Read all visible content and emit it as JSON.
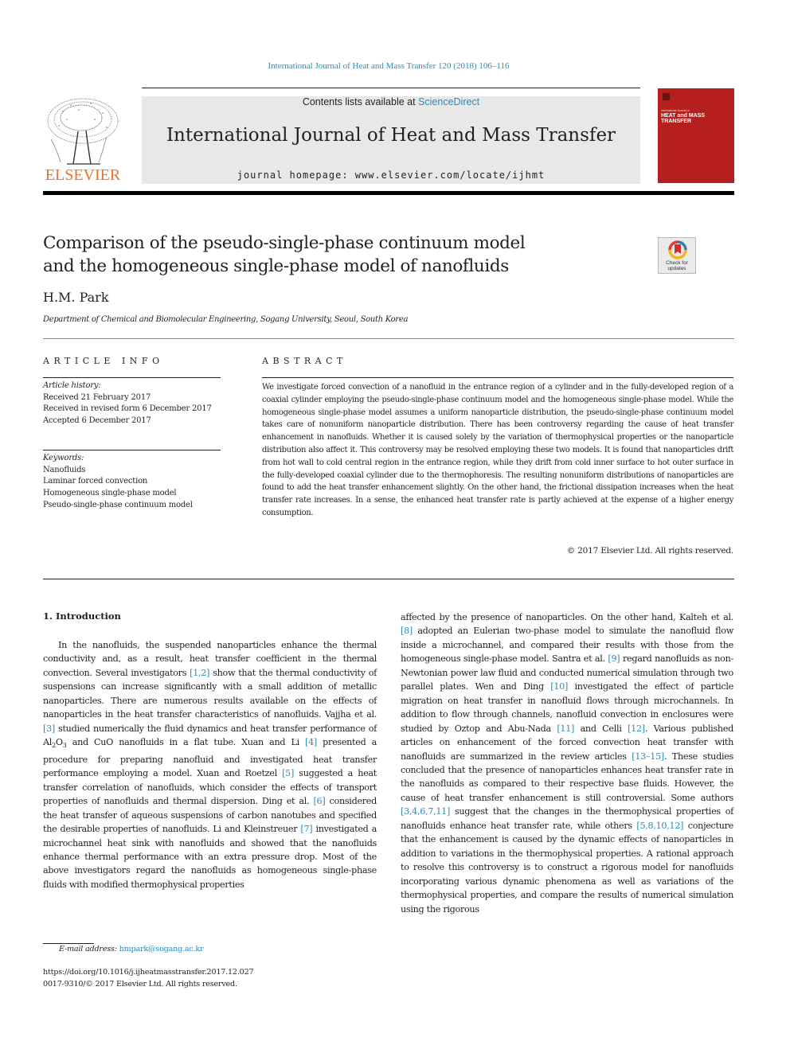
{
  "header": {
    "running_head": "International Journal of Heat and Mass Transfer 120 (2018) 106–116",
    "publisher_logo_text": "ELSEVIER",
    "contents_prefix": "Contents lists available at ",
    "contents_link": "ScienceDirect",
    "journal_title": "International Journal of Heat and Mass Transfer",
    "homepage": "journal homepage: www.elsevier.com/locate/ijhmt",
    "cover": {
      "small_line": "International Journal of",
      "big_line_1": "HEAT and MASS",
      "big_line_2": "TRANSFER",
      "color": "#b5201e"
    }
  },
  "article": {
    "title_line_1": "Comparison of the pseudo-single-phase continuum model",
    "title_line_2": "and the homogeneous single-phase model of nanofluids",
    "check_badge_line_1": "Check for",
    "check_badge_line_2": "updates",
    "author": "H.M. Park",
    "affiliation": "Department of Chemical and Biomolecular Engineering, Sogang University, Seoul, South Korea"
  },
  "article_info": {
    "heading": "ARTICLE INFO",
    "history_label": "Article history:",
    "history": [
      "Received 21 February 2017",
      "Received in revised form 6 December 2017",
      "Accepted 6 December 2017"
    ],
    "keywords_label": "Keywords:",
    "keywords": [
      "Nanofluids",
      "Laminar forced convection",
      "Homogeneous single-phase model",
      "Pseudo-single-phase continuum model"
    ]
  },
  "abstract": {
    "heading": "ABSTRACT",
    "text": "We investigate forced convection of a nanofluid in the entrance region of a cylinder and in the fully-developed region of a coaxial cylinder employing the pseudo-single-phase continuum model and the homogeneous single-phase model. While the homogeneous single-phase model assumes a uniform nanoparticle distribution, the pseudo-single-phase continuum model takes care of nonuniform nanoparticle distribution. There has been controversy regarding the cause of heat transfer enhancement in nanofluids. Whether it is caused solely by the variation of thermophysical properties or the nanoparticle distribution also affect it. This controversy may be resolved employing these two models. It is found that nanoparticles drift from hot wall to cold central region in the entrance region, while they drift from cold inner surface to hot outer surface in the fully-developed coaxial cylinder due to the thermophoresis. The resulting nonuniform distributions of nanoparticles are found to add the heat transfer enhancement slightly. On the other hand, the frictional dissipation increases when the heat transfer rate increases. In a sense, the enhanced heat transfer rate is partly achieved at the expense of a higher energy consumption.",
    "copyright": "© 2017 Elsevier Ltd. All rights reserved."
  },
  "introduction": {
    "heading": "1. Introduction",
    "left_column": [
      {
        "t": "In the nanofluids, the suspended nanoparticles enhance the thermal conductivity and, as a result, heat transfer coefficient in the thermal convection. Several investigators "
      },
      {
        "ref": "[1,2]"
      },
      {
        "t": " show that the thermal conductivity of suspensions can increase significantly with a small addition of metallic nanoparticles. There are numerous results available on the effects of nanoparticles in the heat transfer characteristics of nanofluids. Vajjha et al. "
      },
      {
        "ref": "[3]"
      },
      {
        "t": " studied numerically the fluid dynamics and heat transfer performance of Al"
      },
      {
        "sub": "2"
      },
      {
        "t": "O"
      },
      {
        "sub": "3"
      },
      {
        "t": " and CuO nanofluids in a flat tube. Xuan and Li "
      },
      {
        "ref": "[4]"
      },
      {
        "t": " presented a procedure for preparing nanofluid and investigated heat transfer performance employing a model. Xuan and Roetzel "
      },
      {
        "ref": "[5]"
      },
      {
        "t": " suggested a heat transfer correlation of nanofluids, which consider the effects of transport properties of nanofluids and thermal dispersion. Ding et al. "
      },
      {
        "ref": "[6]"
      },
      {
        "t": " considered the heat transfer of aqueous suspensions of carbon nanotubes and specified the desirable properties of nanofluids. Li and Kleinstreuer "
      },
      {
        "ref": "[7]"
      },
      {
        "t": " investigated a microchannel heat sink with nanofluids and showed that the nanofluids enhance thermal performance with an extra pressure drop. Most of the above investigators regard the nanofluids as homogeneous single-phase fluids with modified thermophysical properties"
      }
    ],
    "right_column": [
      {
        "t": "affected by the presence of nanoparticles. On the other hand, Kalteh et al. "
      },
      {
        "ref": "[8]"
      },
      {
        "t": " adopted an Eulerian two-phase model to simulate the nanofluid flow inside a microchannel, and compared their results with those from the homogeneous single-phase model. Santra et al. "
      },
      {
        "ref": "[9]"
      },
      {
        "t": " regard nanofluids as non-Newtonian power law fluid and conducted numerical simulation through two parallel plates. Wen and Ding "
      },
      {
        "ref": "[10]"
      },
      {
        "t": " investigated the effect of particle migration on heat transfer in nanofluid flows through microchannels. In addition to flow through channels, nanofluid convection in enclosures were studied by Oztop and Abu-Nada "
      },
      {
        "ref": "[11]"
      },
      {
        "t": " and Celli "
      },
      {
        "ref": "[12]"
      },
      {
        "t": ". Various published articles on enhancement of the forced convection heat transfer with nanofluids are summarized in the review articles "
      },
      {
        "ref": "[13–15]"
      },
      {
        "t": ". These studies concluded that the presence of nanoparticles enhances heat transfer rate in the nanofluids as compared to their respective base fluids. However, the cause of heat transfer enhancement is still controversial. Some authors "
      },
      {
        "ref": "[3,4,6,7,11]"
      },
      {
        "t": " suggest that the changes in the thermophysical properties of nanofluids enhance heat transfer rate, while others "
      },
      {
        "ref": "[5,8,10,12]"
      },
      {
        "t": " conjecture that the enhancement is caused by the dynamic effects of nanoparticles in addition to variations in the thermophysical properties. A rational approach to resolve this controversy is to construct a rigorous model for nanofluids incorporating various dynamic phenomena as well as variations of the thermophysical properties, and compare the results of numerical simulation using the rigorous"
      }
    ]
  },
  "footnote": {
    "email_label": "E-mail address: ",
    "email": "hmpark@sogang.ac.kr",
    "doi": "https://doi.org/10.1016/j.ijheatmasstransfer.2017.12.027",
    "issn_line": "0017-9310/© 2017 Elsevier Ltd. All rights reserved."
  },
  "colors": {
    "link": "#2a8bb8",
    "elsevier_orange": "#f37021",
    "banner_gray": "#e8e8e8"
  }
}
